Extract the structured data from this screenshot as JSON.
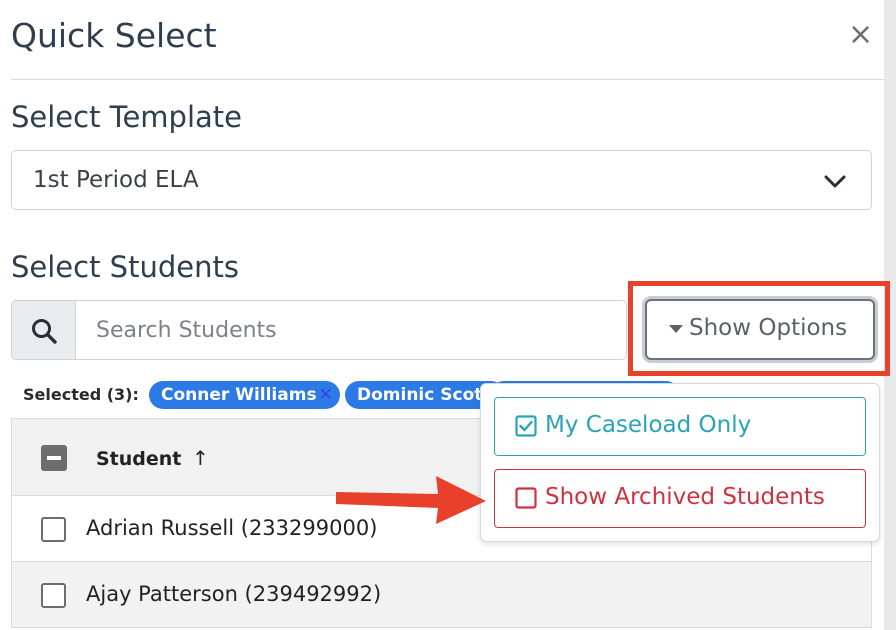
{
  "dialog": {
    "title": "Quick Select",
    "close_glyph": "×"
  },
  "template": {
    "label": "Select Template",
    "selected": "1st Period ELA"
  },
  "students": {
    "label": "Select Students",
    "search_placeholder": "Search Students",
    "show_options_label": "Show Options",
    "selected_label": "Selected (3):",
    "selected_chips": [
      {
        "name": "Conner Williams"
      },
      {
        "name": "Dominic Scott"
      },
      {
        "name": ""
      }
    ]
  },
  "options_menu": {
    "items": [
      {
        "label": "My Caseload Only",
        "checked": true,
        "color": "#2aa3b8"
      },
      {
        "label": "Show Archived Students",
        "checked": false,
        "color": "#d0313f"
      }
    ]
  },
  "table": {
    "header": "Student",
    "sort_glyph": "↑",
    "rows": [
      {
        "label": "Adrian Russell (233299000)"
      },
      {
        "label": "Ajay Patterson (239492992)"
      }
    ]
  },
  "colors": {
    "highlight": "#e8402a",
    "chip": "#2c7ae5",
    "caseload": "#2aa3b8",
    "archived": "#d0313f"
  },
  "icons": {
    "search": "search-icon",
    "dropdown": "chevron-down-icon",
    "options_caret": "caret-down-icon",
    "checked": "checked-box-icon",
    "unchecked": "unchecked-box-icon",
    "annotation": "red-arrow-icon"
  }
}
